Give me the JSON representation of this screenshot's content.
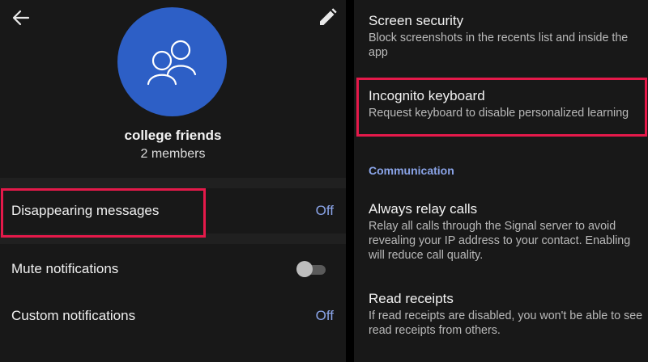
{
  "group": {
    "name": "college friends",
    "members": "2 members"
  },
  "icons": {
    "back": "arrow-left-icon",
    "edit": "pencil-icon",
    "avatar": "group-people-icon"
  },
  "left_rows": {
    "disappearing": {
      "label": "Disappearing messages",
      "value": "Off"
    },
    "mute": {
      "label": "Mute notifications",
      "toggle_on": false
    },
    "custom": {
      "label": "Custom notifications",
      "value": "Off"
    }
  },
  "right_settings": {
    "screen_security": {
      "title": "Screen security",
      "desc": "Block screenshots in the recents list and inside the app"
    },
    "incognito": {
      "title": "Incognito keyboard",
      "desc": "Request keyboard to disable personalized learning"
    },
    "section_communication": "Communication",
    "relay_calls": {
      "title": "Always relay calls",
      "desc": "Relay all calls through the Signal server to avoid revealing your IP address to your contact. Enabling will reduce call quality."
    },
    "read_receipts": {
      "title": "Read receipts",
      "desc": "If read receipts are disabled, you won't be able to see read receipts from others."
    }
  },
  "colors": {
    "accent": "#8aa4e8",
    "avatar_bg": "#2d5fc6",
    "highlight": "#e5194a",
    "panel_bg": "#181818"
  }
}
